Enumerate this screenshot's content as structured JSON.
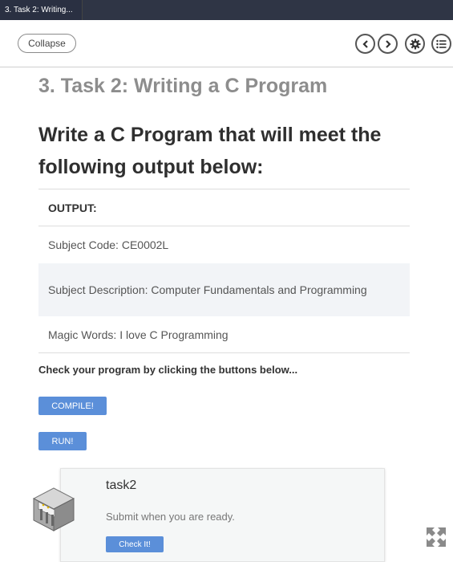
{
  "tab": {
    "title": "3. Task 2: Writing..."
  },
  "toolbar": {
    "collapse_label": "Collapse",
    "icons": [
      "chevron-left-icon",
      "chevron-right-icon",
      "gear-icon",
      "list-icon"
    ]
  },
  "content": {
    "subtitle": "3. Task 2: Writing a C Program",
    "heading": "Write a C Program that will meet the following output below:",
    "table": {
      "header": "OUTPUT:",
      "rows": [
        "Subject Code: CE0002L",
        "Subject Description: Computer Fundamentals and Programming",
        "Magic Words: I love C Programming"
      ]
    },
    "check_text": "Check your program by clicking the buttons below...",
    "compile_label": "COMPILE!",
    "run_label": "RUN!"
  },
  "card": {
    "title": "task2",
    "text": "Submit when you are ready.",
    "button_label": "Check It!"
  },
  "colors": {
    "accent": "#5b8fd9",
    "topbar": "#2f3545"
  }
}
